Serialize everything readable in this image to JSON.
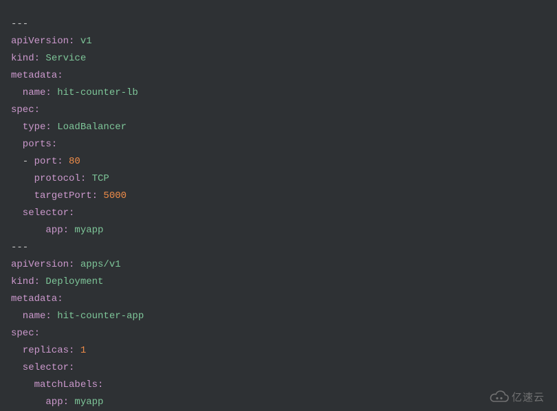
{
  "code_lines": [
    {
      "parts": [
        {
          "cls": "d",
          "t": "---"
        }
      ]
    },
    {
      "parts": [
        {
          "cls": "k",
          "t": "apiVersion:"
        },
        {
          "cls": "s",
          "t": " v1"
        }
      ]
    },
    {
      "parts": [
        {
          "cls": "k",
          "t": "kind:"
        },
        {
          "cls": "s",
          "t": " Service"
        }
      ]
    },
    {
      "parts": [
        {
          "cls": "k",
          "t": "metadata:"
        }
      ]
    },
    {
      "parts": [
        {
          "cls": "k",
          "t": "  name:"
        },
        {
          "cls": "s",
          "t": " hit-counter-lb"
        }
      ]
    },
    {
      "parts": [
        {
          "cls": "k",
          "t": "spec:"
        }
      ]
    },
    {
      "parts": [
        {
          "cls": "k",
          "t": "  type:"
        },
        {
          "cls": "s",
          "t": " LoadBalancer"
        }
      ]
    },
    {
      "parts": [
        {
          "cls": "k",
          "t": "  ports:"
        }
      ]
    },
    {
      "parts": [
        {
          "cls": "d",
          "t": "  - "
        },
        {
          "cls": "k",
          "t": "port:"
        },
        {
          "cls": "n",
          "t": " 80"
        }
      ]
    },
    {
      "parts": [
        {
          "cls": "k",
          "t": "    protocol:"
        },
        {
          "cls": "s",
          "t": " TCP"
        }
      ]
    },
    {
      "parts": [
        {
          "cls": "k",
          "t": "    targetPort:"
        },
        {
          "cls": "n",
          "t": " 5000"
        }
      ]
    },
    {
      "parts": [
        {
          "cls": "k",
          "t": "  selector:"
        }
      ]
    },
    {
      "parts": [
        {
          "cls": "k",
          "t": "      app:"
        },
        {
          "cls": "s",
          "t": " myapp"
        }
      ]
    },
    {
      "parts": [
        {
          "cls": "d",
          "t": "---"
        }
      ]
    },
    {
      "parts": [
        {
          "cls": "k",
          "t": "apiVersion:"
        },
        {
          "cls": "s",
          "t": " apps/v1"
        }
      ]
    },
    {
      "parts": [
        {
          "cls": "k",
          "t": "kind:"
        },
        {
          "cls": "s",
          "t": " Deployment"
        }
      ]
    },
    {
      "parts": [
        {
          "cls": "k",
          "t": "metadata:"
        }
      ]
    },
    {
      "parts": [
        {
          "cls": "k",
          "t": "  name:"
        },
        {
          "cls": "s",
          "t": " hit-counter-app"
        }
      ]
    },
    {
      "parts": [
        {
          "cls": "k",
          "t": "spec:"
        }
      ]
    },
    {
      "parts": [
        {
          "cls": "k",
          "t": "  replicas:"
        },
        {
          "cls": "n",
          "t": " 1"
        }
      ]
    },
    {
      "parts": [
        {
          "cls": "k",
          "t": "  selector:"
        }
      ]
    },
    {
      "parts": [
        {
          "cls": "k",
          "t": "    matchLabels:"
        }
      ]
    },
    {
      "parts": [
        {
          "cls": "k",
          "t": "      app:"
        },
        {
          "cls": "s",
          "t": " myapp"
        }
      ]
    }
  ],
  "watermark": {
    "text": "亿速云"
  }
}
